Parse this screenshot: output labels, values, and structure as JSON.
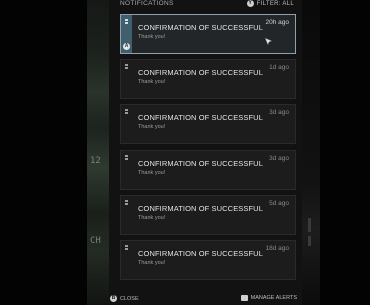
{
  "header": {
    "title": "NOTIFICATIONS",
    "filter_key": "Y",
    "filter_label": "FILTER: ALL"
  },
  "notifications": [
    {
      "title": "CONFIRMATION OF SUCCESSFUL",
      "message": "Thank you!",
      "age": "20h ago",
      "selected": true,
      "action_key": "A"
    },
    {
      "title": "CONFIRMATION OF SUCCESSFUL",
      "message": "Thank you!",
      "age": "1d ago"
    },
    {
      "title": "CONFIRMATION OF SUCCESSFUL",
      "message": "Thank you!",
      "age": "3d ago"
    },
    {
      "title": "CONFIRMATION OF SUCCESSFUL",
      "message": "Thank you!",
      "age": "3d ago"
    },
    {
      "title": "CONFIRMATION OF SUCCESSFUL",
      "message": "Thank you!",
      "age": "5d ago"
    },
    {
      "title": "CONFIRMATION OF SUCCESSFUL",
      "message": "Thank you!",
      "age": "18d ago"
    }
  ],
  "footer": {
    "close_key": "B",
    "close_label": "CLOSE",
    "manage_label": "MANAGE ALERTS"
  },
  "background": {
    "left_glyphs": [
      "12",
      "CH"
    ]
  },
  "colors": {
    "panel_bg": "#121212",
    "card_bg": "#1c1c1c",
    "selected_border": "#8ea2ad",
    "selected_accent": "#3f5f6e"
  },
  "icons": {
    "filter": "y-button-icon",
    "notification": "tag-icon",
    "cursor": "pointer-cursor-icon",
    "close": "b-button-icon",
    "manage": "view-button-icon"
  }
}
